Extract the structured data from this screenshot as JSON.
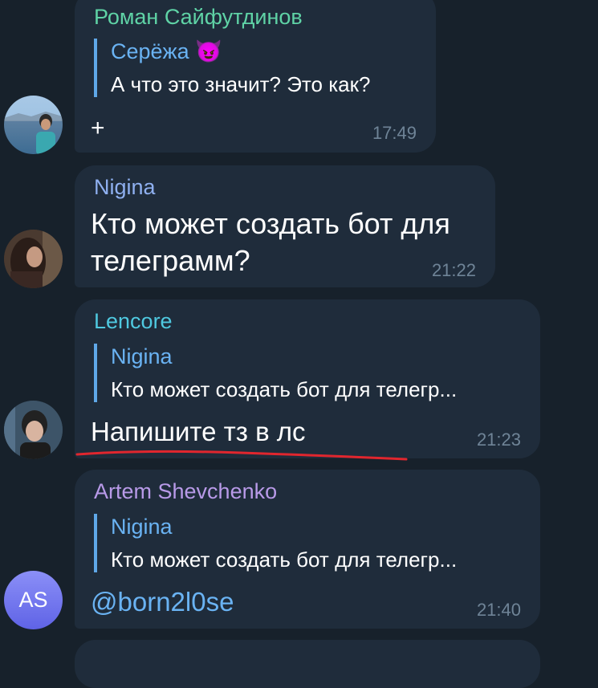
{
  "messages": [
    {
      "sender": "Роман Сайфутдинов",
      "sender_color": "#5fd3a6",
      "reply": {
        "author": "Серёжа 😈",
        "text": "А что это значит? Это как?"
      },
      "text": "+",
      "time": "17:49"
    },
    {
      "sender": "Nigina",
      "sender_color": "#8fb0f0",
      "text_lines": [
        "Кто может создать бот для",
        "телеграмм?"
      ],
      "time": "21:22"
    },
    {
      "sender": "Lencore",
      "sender_color": "#4fc9e0",
      "reply": {
        "author": "Nigina",
        "text": "Кто может создать бот для телегр..."
      },
      "text": "Напишите тз в лс",
      "time": "21:23"
    },
    {
      "sender": "Artem Shevchenko",
      "sender_color": "#b89ae8",
      "avatar_initials": "AS",
      "reply": {
        "author": "Nigina",
        "text": "Кто может создать бот для телегр..."
      },
      "text": "@born2l0se",
      "time": "21:40"
    }
  ],
  "colors": {
    "background": "#17212b",
    "bubble": "#1f2c3b",
    "link": "#6ab3f3",
    "underline": "#e0262e"
  }
}
